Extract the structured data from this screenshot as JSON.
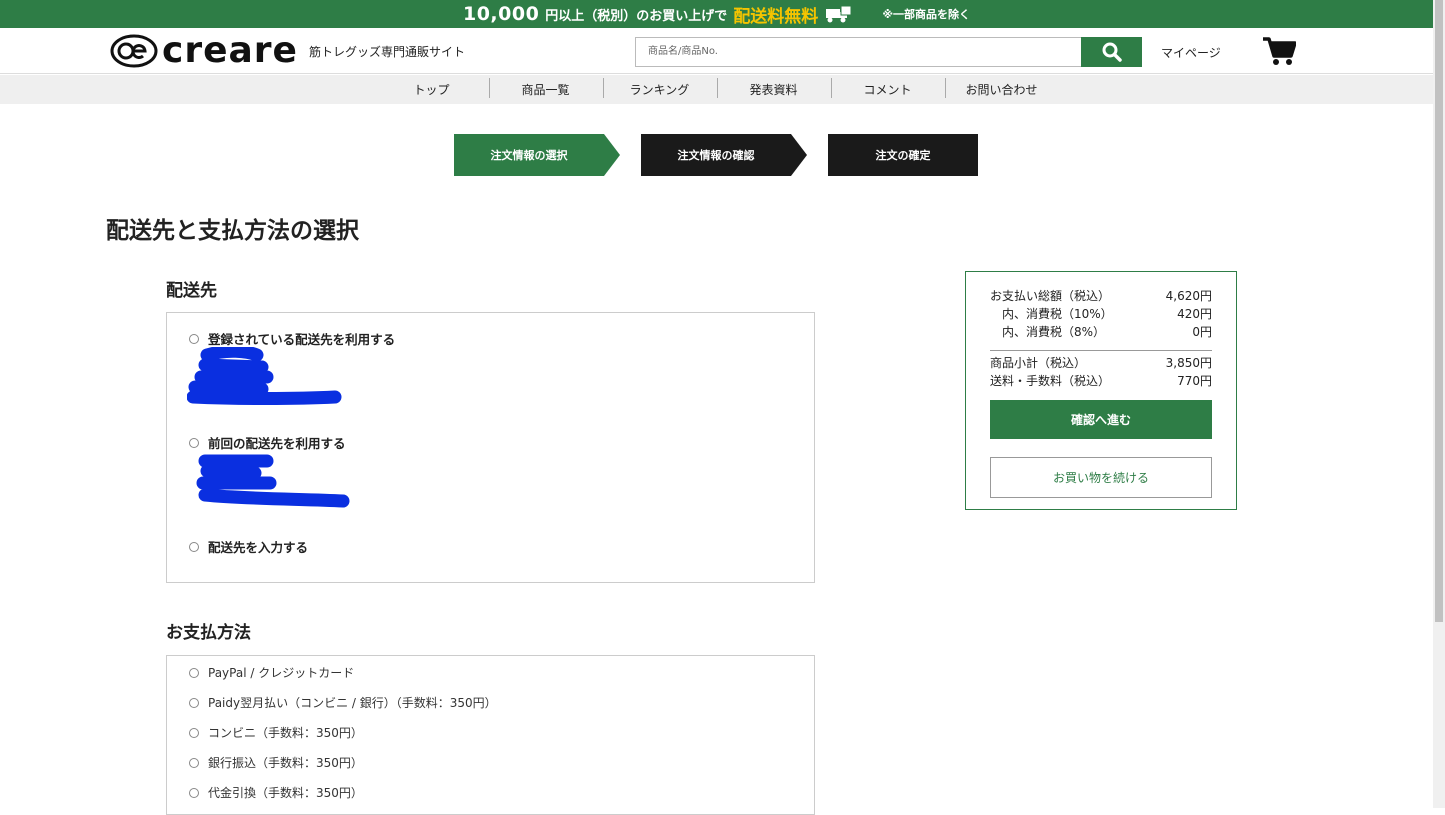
{
  "banner": {
    "amount": "10,000",
    "text1": "円以上（税別）のお買い上げで",
    "free_shipping": "配送料無料",
    "note": "※一部商品を除く"
  },
  "header": {
    "logo_text": "creare",
    "tagline": "筋トレグッズ専門通販サイト",
    "search_placeholder": "商品名/商品No.",
    "mypage": "マイページ"
  },
  "nav": [
    "トップ",
    "商品一覧",
    "ランキング",
    "発表資料",
    "コメント",
    "お問い合わせ"
  ],
  "steps": [
    "注文情報の選択",
    "注文情報の確認",
    "注文の確定"
  ],
  "page_title": "配送先と支払方法の選択",
  "shipping": {
    "title": "配送先",
    "options": [
      "登録されている配送先を利用する",
      "前回の配送先を利用する",
      "配送先を入力する"
    ]
  },
  "payment": {
    "title": "お支払方法",
    "options": [
      "PayPal / クレジットカード",
      "Paidy翌月払い（コンビニ / 銀行）（手数料：350円）",
      "コンビニ（手数料：350円）",
      "銀行振込（手数料：350円）",
      "代金引換（手数料：350円）"
    ]
  },
  "summary": {
    "total_label": "お支払い総額（税込）",
    "total": "4,620円",
    "tax10_label": "内、消費税（10%）",
    "tax10": "420円",
    "tax8_label": "内、消費税（8%）",
    "tax8": "0円",
    "subtotal_label": "商品小計（税込）",
    "subtotal": "3,850円",
    "shipping_label": "送料・手数料（税込）",
    "shipping": "770円",
    "confirm_button": "確認へ進む",
    "continue_button": "お買い物を続ける"
  },
  "colors": {
    "brand_green": "#2e7d46",
    "step_dark": "#1a1a1a",
    "accent_yellow": "#f5c400",
    "redaction_blue": "#0a2fe0"
  }
}
